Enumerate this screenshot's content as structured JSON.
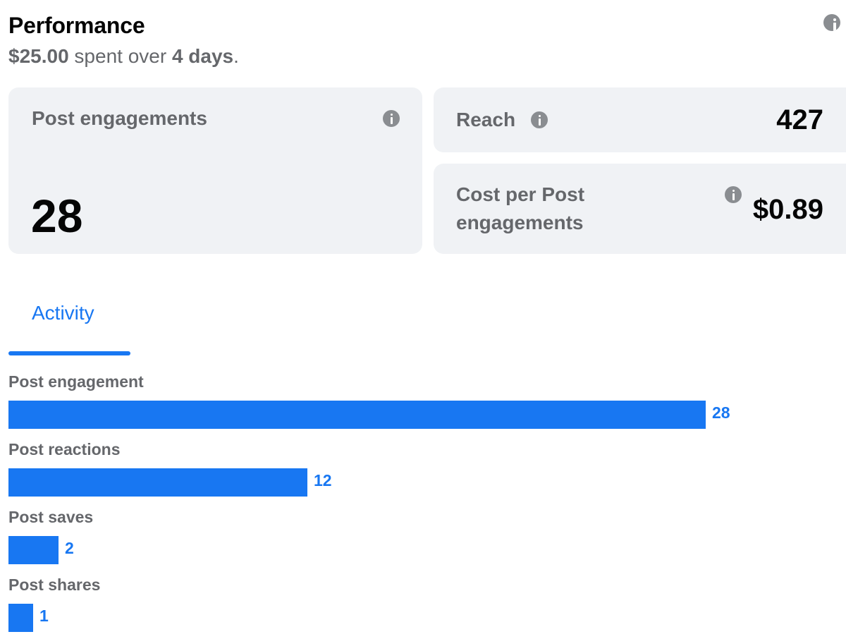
{
  "header": {
    "title": "Performance",
    "spent": "$25.00",
    "spent_mid": " spent over ",
    "days": "4 days",
    "period": "."
  },
  "cards": {
    "post_engagements": {
      "label": "Post engagements",
      "value": "28"
    },
    "reach": {
      "label": "Reach",
      "value": "427"
    },
    "cost_per": {
      "label_line1": "Cost per Post",
      "label_line2": "engagements",
      "value": "$0.89"
    }
  },
  "tabs": [
    {
      "label": "Activity",
      "active": true
    }
  ],
  "activity": {
    "max": 28,
    "rows": [
      {
        "label": "Post engagement",
        "value": 28
      },
      {
        "label": "Post reactions",
        "value": 12
      },
      {
        "label": "Post saves",
        "value": 2
      },
      {
        "label": "Post shares",
        "value": 1
      }
    ]
  },
  "colors": {
    "accent": "#1877f2",
    "card_bg": "#f0f2f5",
    "muted_text": "#65676b",
    "icon_gray": "#8a8d91"
  },
  "icons": {
    "info": "info-icon"
  }
}
